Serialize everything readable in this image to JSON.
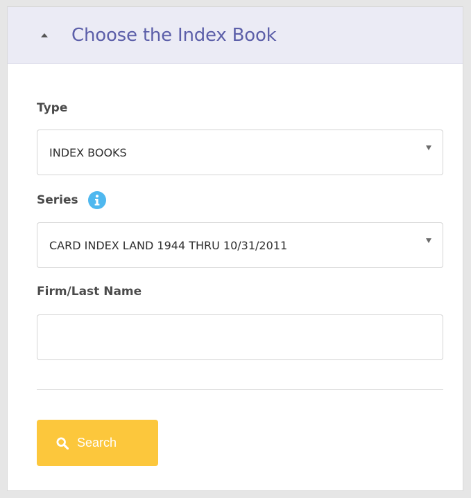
{
  "panel": {
    "title": "Choose the Index Book",
    "header_background": "#ebebf5",
    "title_color": "#5c5fa9",
    "collapse_icon": "caret-up-icon"
  },
  "type_field": {
    "label": "Type",
    "selected_value": "INDEX BOOKS",
    "dropdown_icon": "caret-down-icon"
  },
  "series_field": {
    "label": "Series",
    "info_icon": "info-icon",
    "info_color": "#4fb8ef",
    "selected_value": "CARD INDEX LAND 1944 THRU 10/31/2011",
    "dropdown_icon": "caret-down-icon"
  },
  "name_field": {
    "label": "Firm/Last Name",
    "value": "",
    "placeholder": ""
  },
  "search_button": {
    "label": "Search",
    "icon": "search-icon",
    "color": "#fcc73c"
  }
}
